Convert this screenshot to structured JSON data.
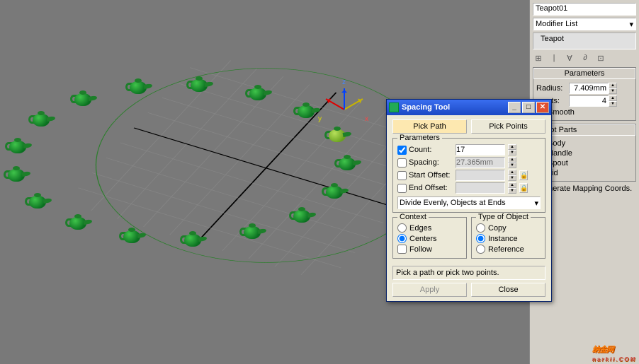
{
  "viewport": {
    "selected_object": "Teapot01",
    "axes": {
      "x": "x",
      "y": "y",
      "z": "z"
    },
    "teapot_count": 17
  },
  "command_panel": {
    "object_name": "Teapot01",
    "modifier_list_label": "Modifier List",
    "stack_item": "Teapot",
    "icons": [
      "⊞",
      "|",
      "∀",
      "∂",
      "⊡"
    ],
    "rollout_parameters": "Parameters",
    "radius_label": "Radius:",
    "radius_value": "7.409mm",
    "segments_label": "ments:",
    "segments_value": "4",
    "smooth_label": "Smooth",
    "teapot_parts_label": "eapot Parts",
    "body_label": "Body",
    "handle_label": "Handle",
    "spout_label": "Spout",
    "lid_label": "Lid",
    "mapping_label": "enerate Mapping Coords."
  },
  "spacing_tool": {
    "title": "Spacing Tool",
    "pick_path": "Pick Path",
    "pick_points": "Pick Points",
    "group_parameters": "Parameters",
    "count_label": "Count:",
    "count_value": "17",
    "count_checked": true,
    "spacing_label": "Spacing:",
    "spacing_value": "27.365mm",
    "spacing_checked": false,
    "start_offset_label": "Start Offset:",
    "start_offset_value": "",
    "end_offset_label": "End Offset:",
    "end_offset_value": "",
    "mode": "Divide Evenly, Objects at Ends",
    "context_label": "Context",
    "context_edges": "Edges",
    "context_centers": "Centers",
    "context_follow": "Follow",
    "type_label": "Type of Object",
    "type_copy": "Copy",
    "type_instance": "Instance",
    "type_reference": "Reference",
    "status_text": "Pick a path or pick two points.",
    "apply": "Apply",
    "close": "Close"
  },
  "watermark": {
    "brand": "纳金网",
    "url": "narkii.COM"
  }
}
